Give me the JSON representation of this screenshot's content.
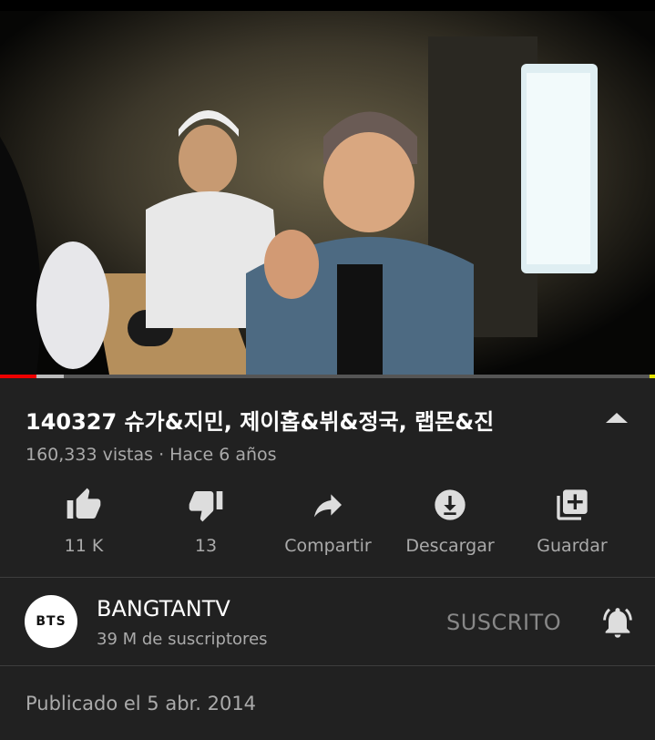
{
  "video": {
    "title": "140327 슈가&지민, 제이홉&뷔&정국, 랩몬&진",
    "meta": "160,333 vistas · Hace 6 años"
  },
  "actions": {
    "like": "11 K",
    "dislike": "13",
    "share": "Compartir",
    "download": "Descargar",
    "save": "Guardar"
  },
  "channel": {
    "avatar_text": "BTS",
    "name": "BANGTANTV",
    "subscribers": "39 M de suscriptores",
    "subscribe_state": "SUSCRITO"
  },
  "published": "Publicado el 5 abr. 2014",
  "colors": {
    "background": "#212121",
    "progress_played": "#ee0000",
    "text_secondary": "#aaaaaa"
  }
}
